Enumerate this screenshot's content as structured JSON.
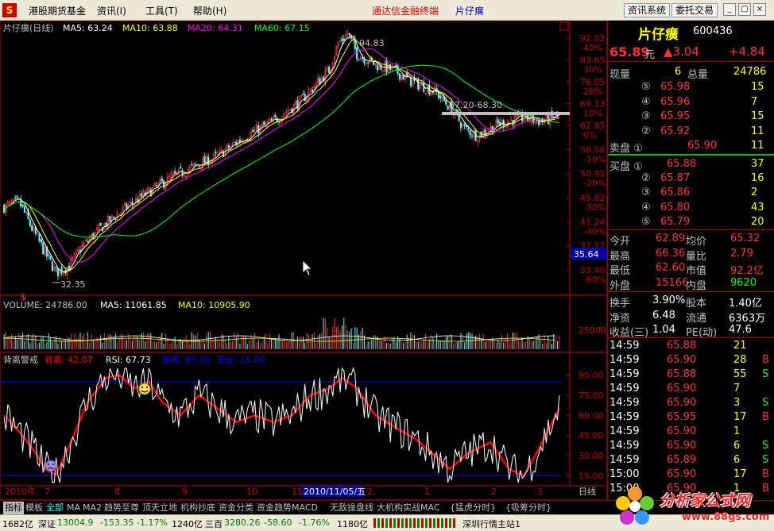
{
  "menu": {
    "icon_label": "S",
    "items": [
      "港股期货基金",
      "资讯(I)",
      "工具(T)",
      "帮助(H)"
    ],
    "app_title": "通达信金融终端",
    "stock_title": "片仔癀",
    "btn_info": "资讯系统",
    "btn_trade": "委托交易",
    "win_min": "_",
    "win_max": "□",
    "win_close": "×"
  },
  "main": {
    "legend": {
      "name": "片仔癀(日线)",
      "ma5": "MA5: 63.24",
      "ma10": "MA10: 63.88",
      "ma20": "MA20: 64.31",
      "ma60": "MA60: 67.15"
    },
    "price_axis": [
      "92.02",
      "83.65",
      "76.05",
      "69.13",
      "62.85",
      "56.56",
      "50.91",
      "45.82",
      "41.24",
      "37.12",
      "33.40"
    ],
    "pct_axis": [
      "40%",
      "30%",
      "20%",
      "10%",
      "0%",
      "-10%",
      "-20%",
      "-30%",
      "-40%",
      "-50%",
      "-60%"
    ],
    "high_label": "94.83",
    "low_label": "32.35",
    "range_label": "67.20-68.30",
    "cursor_price": "35.64",
    "s_mark": "$"
  },
  "volume": {
    "legend": {
      "label": "VOLUME: 24786.00",
      "ma5": "MA5: 11061.85",
      "ma10": "MA10: 10905.90"
    },
    "axis_label": "25000"
  },
  "indicator": {
    "legend": {
      "name": "背离警戒",
      "beili": "背离: 42.07",
      "rsi": "RSI: 67.73",
      "warn": "警戒: 85.00",
      "safe": "安全: 15.00"
    },
    "axis": [
      "90.00",
      "75.00",
      "60.00",
      "45.00",
      "30.00",
      "15.00"
    ]
  },
  "xaxis": {
    "labels": [
      "2010年",
      "7",
      "8",
      "9",
      "10",
      "11",
      "2010/11/05/五",
      "2",
      "1",
      "2",
      "3"
    ],
    "period": "日线"
  },
  "quote": {
    "name": "片仔癀",
    "code": "600436",
    "price": "65.89",
    "unit": "元",
    "change": "▲3.04",
    "pct": "+4.84",
    "xianliang_label": "现量",
    "xianliang": "6",
    "zongliang_label": "总量",
    "zongliang": "24786",
    "sell": [
      {
        "lv": "⑤",
        "price": "65.98",
        "vol": "15"
      },
      {
        "lv": "④",
        "price": "65.96",
        "vol": "7"
      },
      {
        "lv": "③",
        "price": "65.95",
        "vol": "15"
      },
      {
        "lv": "②",
        "price": "65.92",
        "vol": "11"
      },
      {
        "lv": "卖盘 ①",
        "price": "65.90",
        "vol": "11"
      }
    ],
    "buy": [
      {
        "lv": "买盘 ①",
        "price": "65.88",
        "vol": "37"
      },
      {
        "lv": "②",
        "price": "65.87",
        "vol": "16"
      },
      {
        "lv": "③",
        "price": "65.86",
        "vol": "2"
      },
      {
        "lv": "④",
        "price": "65.80",
        "vol": "43"
      },
      {
        "lv": "⑤",
        "price": "65.79",
        "vol": "20"
      }
    ],
    "stats": [
      {
        "l1": "今开",
        "v1": "62.89",
        "l2": "均价",
        "v2": "65.32"
      },
      {
        "l1": "最高",
        "v1": "66.36",
        "l2": "量比",
        "v2": "2.79"
      },
      {
        "l1": "最低",
        "v1": "62.60",
        "l2": "市值",
        "v2": "92.2亿"
      },
      {
        "l1": "外盘",
        "v1": "15166",
        "l2": "内盘",
        "v2": "9620"
      }
    ],
    "fin": [
      {
        "l1": "换手",
        "v1": "3.90%",
        "l2": "股本",
        "v2": "1.40亿"
      },
      {
        "l1": "净资",
        "v1": "6.48",
        "l2": "流通",
        "v2": "6363万"
      },
      {
        "l1": "收益(三)",
        "v1": "1.04",
        "l2": "PE(动)",
        "v2": "47.6"
      }
    ],
    "ticks": [
      {
        "t": "14:59",
        "p": "65.88",
        "v": "21",
        "s": ""
      },
      {
        "t": "14:59",
        "p": "65.90",
        "v": "28",
        "s": "B"
      },
      {
        "t": "14:59",
        "p": "65.88",
        "v": "55",
        "s": "S"
      },
      {
        "t": "14:59",
        "p": "65.90",
        "v": "7",
        "s": ""
      },
      {
        "t": "14:59",
        "p": "65.90",
        "v": "3",
        "s": "S"
      },
      {
        "t": "14:59",
        "p": "65.95",
        "v": "17",
        "s": "B"
      },
      {
        "t": "14:59",
        "p": "65.90",
        "v": "1",
        "s": ""
      },
      {
        "t": "14:59",
        "p": "65.90",
        "v": "6",
        "s": "S"
      },
      {
        "t": "14:59",
        "p": "65.89",
        "v": "6",
        "s": "S"
      },
      {
        "t": "15:00",
        "p": "65.90",
        "v": "17",
        "s": "B"
      },
      {
        "t": "15:00",
        "p": "65.90",
        "v": "1",
        "s": "B"
      }
    ]
  },
  "tabs": [
    "指标",
    "模板",
    "全部",
    "MA",
    "MA2",
    "趋势至尊",
    "顶天立地",
    "机构抄底",
    "资金分类",
    "资金趋势MACD",
    "无敌操盘线",
    "大机构实战MAC",
    "{猛虎分时}",
    "{吸筹分时}"
  ],
  "status": {
    "s0": "1682亿",
    "s1": "深证",
    "s2": "13004.9",
    "s3": "-153.35",
    "s4": "-1.17%",
    "s5": "1240亿",
    "s6": "三百",
    "s7": "3280.26",
    "s8": "-58.60",
    "s9": "-1.76%",
    "s10": "1180亿",
    "s11": "深圳行情主站1"
  },
  "watermark": {
    "title": "分析家公式网",
    "url": "www.88gs.com"
  },
  "colors": {
    "up": "#FF3232",
    "down": "#54FFFF",
    "ma5": "#FFFFFF",
    "ma10": "#FFFF00",
    "ma20": "#FF00FF",
    "ma60": "#00FF00",
    "axis": "#C00000",
    "rsi": "#FFFFFF",
    "beili": "#FF0000",
    "level": "#0000FF"
  },
  "chart_data": [
    {
      "type": "line",
      "title": "片仔癀(日线)",
      "ylim": [
        32.35,
        94.83
      ],
      "series": [
        {
          "name": "MA5",
          "last": 63.24
        },
        {
          "name": "MA10",
          "last": 63.88
        },
        {
          "name": "MA20",
          "last": 64.31
        },
        {
          "name": "MA60",
          "last": 67.15
        }
      ],
      "annotations": [
        "94.83",
        "32.35",
        "67.20-68.30"
      ]
    },
    {
      "type": "bar",
      "title": "VOLUME",
      "series": [
        {
          "name": "VOLUME",
          "last": 24786.0
        },
        {
          "name": "MA5",
          "last": 11061.85
        },
        {
          "name": "MA10",
          "last": 10905.9
        }
      ]
    },
    {
      "type": "line",
      "title": "背离警戒",
      "ylim": [
        0,
        100
      ],
      "series": [
        {
          "name": "背离",
          "last": 42.07
        },
        {
          "name": "RSI",
          "last": 67.73
        },
        {
          "name": "警戒",
          "last": 85.0
        },
        {
          "name": "安全",
          "last": 15.0
        }
      ]
    }
  ]
}
